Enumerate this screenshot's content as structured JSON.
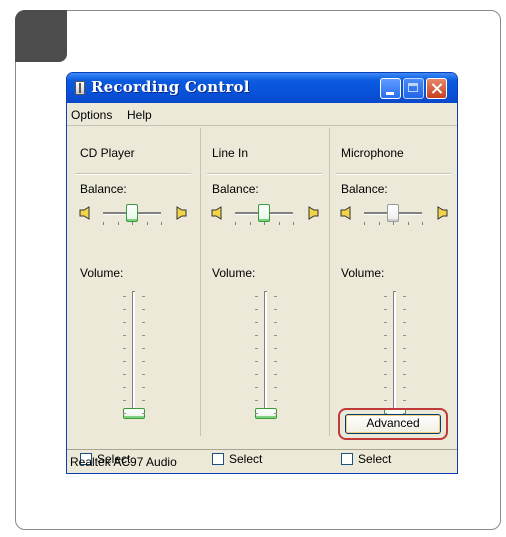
{
  "window": {
    "title": "Recording Control"
  },
  "menu": {
    "items": [
      "Options",
      "Help"
    ]
  },
  "columns": [
    {
      "name": "CD Player",
      "balance_label": "Balance:",
      "volume_label": "Volume:",
      "select_label": "Select",
      "selected": false,
      "balance_level": 0.5,
      "volume_level": 0.0,
      "thumb_color": "green"
    },
    {
      "name": "Line In",
      "balance_label": "Balance:",
      "volume_label": "Volume:",
      "select_label": "Select",
      "selected": false,
      "balance_level": 0.5,
      "volume_level": 0.0,
      "thumb_color": "green"
    },
    {
      "name": "Microphone",
      "balance_label": "Balance:",
      "volume_label": "Volume:",
      "select_label": "Select",
      "selected": false,
      "balance_level": 0.5,
      "volume_level": 0.0,
      "thumb_color": "grey",
      "advanced_label": "Advanced"
    }
  ],
  "status": {
    "device": "Realtek AC97 Audio"
  },
  "colors": {
    "title_bar": "#0a5be0",
    "window_bg": "#ece9d8",
    "highlight_ring": "#c0393b",
    "active_thumb": "#3a9a3a"
  },
  "icons": {
    "title": "mixer-icon",
    "speaker_left": "speaker-left-icon",
    "speaker_right": "speaker-right-icon"
  }
}
